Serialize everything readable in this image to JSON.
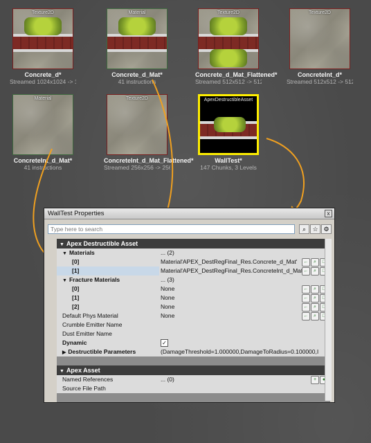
{
  "assets": [
    {
      "kind": "Texture2D",
      "name": "Concrete_d*",
      "info": "Streamed 1024x1024 -> 102...",
      "style": "tex-brick"
    },
    {
      "kind": "Material",
      "name": "Concrete_d_Mat*",
      "info": "41 instructions",
      "style": "mat-brick"
    },
    {
      "kind": "Texture2D",
      "name": "Concrete_d_Mat_Flattened*",
      "info": "Streamed 512x512 -> 512x5...",
      "style": "tex-brick"
    },
    {
      "kind": "Texture2D",
      "name": "ConcreteInt_d*",
      "info": "Streamed 512x512 -> 512x5...",
      "style": "plain"
    },
    {
      "kind": "Material",
      "name": "ConcreteInt_d_Mat*",
      "info": "41 instructions",
      "style": "mat-plain"
    },
    {
      "kind": "Texture2D",
      "name": "ConcreteInt_d_Mat_Flattened*",
      "info": "Streamed 256x256 -> 256x2...",
      "style": "plain"
    },
    {
      "kind": "ApexDestructibleAsset",
      "name": "WallTest*",
      "info": "147 Chunks, 3 Levels",
      "style": "selected"
    }
  ],
  "window": {
    "title": "WallTest Properties",
    "close": "x",
    "search_placeholder": "Type here to search"
  },
  "sections": {
    "destructible": {
      "header": "Apex Destructible Asset",
      "rows": [
        {
          "key": "Materials",
          "value": "... (2)",
          "bold": true,
          "tri": "▼"
        },
        {
          "key": "[0]",
          "value": "Material'APEX_DestRegFinal_Res.Concrete_d_Mat'",
          "bold": true,
          "indent": true,
          "icons": true
        },
        {
          "key": "[1]",
          "value": "Material'APEX_DestRegFinal_Res.ConcreteInt_d_Mat'",
          "bold": true,
          "indent": true,
          "icons": true
        },
        {
          "key": "Fracture Materials",
          "value": "... (3)",
          "bold": true,
          "tri": "▼"
        },
        {
          "key": "[0]",
          "value": "None",
          "bold": true,
          "indent": true,
          "icons": true
        },
        {
          "key": "[1]",
          "value": "None",
          "bold": true,
          "indent": true,
          "icons": true
        },
        {
          "key": "[2]",
          "value": "None",
          "bold": true,
          "indent": true,
          "icons": true
        },
        {
          "key": "Default Phys Material",
          "value": "None",
          "bold": false,
          "icons": true
        },
        {
          "key": "Crumble Emitter Name",
          "value": "",
          "bold": false
        },
        {
          "key": "Dust Emitter Name",
          "value": "",
          "bold": false
        },
        {
          "key": "Dynamic",
          "value": "✓",
          "bold": true,
          "checkbox": true
        },
        {
          "key": "Destructible Parameters",
          "value": "(DamageThreshold=1.000000,DamageToRadius=0.100000,I",
          "bold": true,
          "tri": "▶"
        }
      ]
    },
    "apex": {
      "header": "Apex Asset",
      "rows": [
        {
          "key": "Named References",
          "value": "... (0)",
          "bold": false
        },
        {
          "key": "Source File Path",
          "value": "",
          "bold": false
        }
      ]
    }
  },
  "colors": {
    "highlight": "#ffee00",
    "arrow": "#f0a020",
    "window_header": "#3c3c3c"
  }
}
